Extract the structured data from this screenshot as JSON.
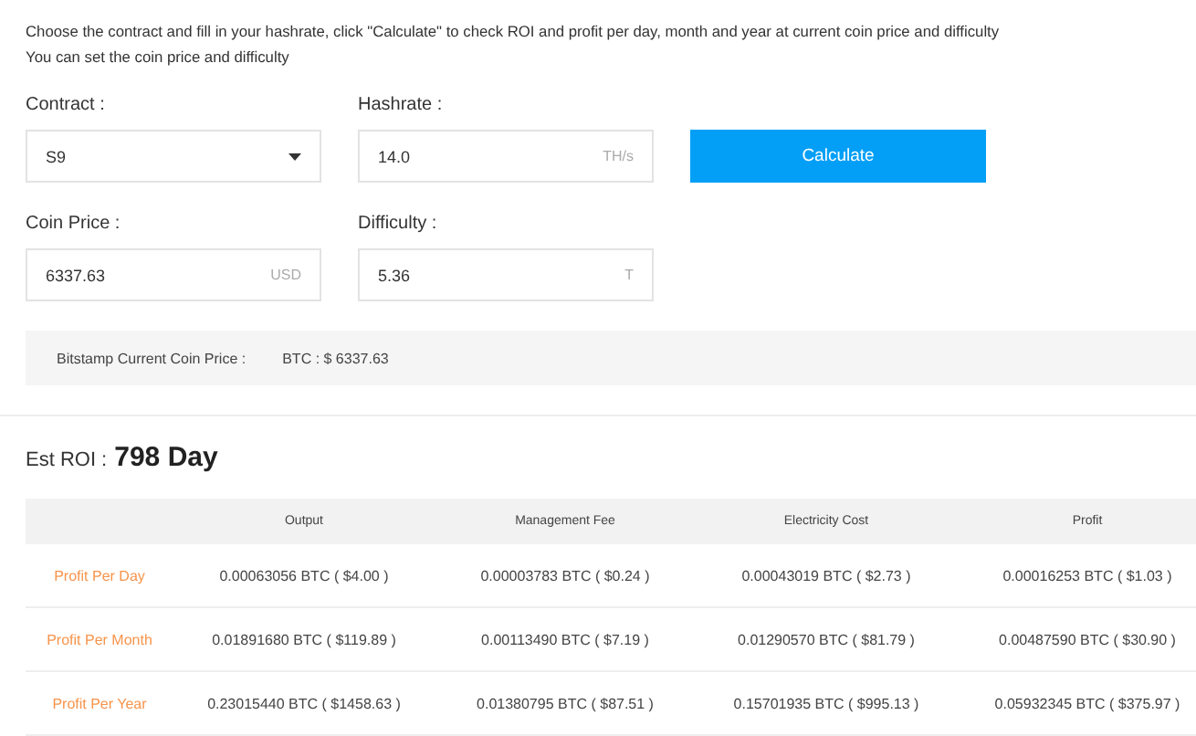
{
  "intro": [
    "Choose the contract and fill in your hashrate, click \"Calculate\" to check ROI and profit per day, month and year at current coin price and difficulty",
    "You can set the coin price and difficulty"
  ],
  "fields": [
    {
      "kind": "select",
      "label": "Contract :",
      "value": "S9"
    },
    {
      "kind": "input",
      "label": "Hashrate :",
      "value": "14.0",
      "unit": "TH/s"
    },
    {
      "kind": "input",
      "label": "Coin Price :",
      "value": "6337.63",
      "unit": "USD"
    },
    {
      "kind": "input",
      "label": "Difficulty :",
      "value": "5.36",
      "unit": "T"
    }
  ],
  "calculate_button": "Calculate",
  "current_price": {
    "label": "Bitstamp Current Coin Price :",
    "value": "BTC : $ 6337.63"
  },
  "roi": {
    "label": "Est ROI :",
    "value": "798 Day"
  },
  "table": {
    "columns": [
      "Output",
      "Management Fee",
      "Electricity Cost",
      "Profit"
    ],
    "rows": [
      {
        "label": "Profit Per Day",
        "cells": [
          "0.00063056 BTC ( $4.00 )",
          "0.00003783 BTC ( $0.24 )",
          "0.00043019 BTC ( $2.73 )",
          "0.00016253 BTC ( $1.03 )"
        ]
      },
      {
        "label": "Profit Per Month",
        "cells": [
          "0.01891680 BTC ( $119.89 )",
          "0.00113490 BTC ( $7.19 )",
          "0.01290570 BTC ( $81.79 )",
          "0.00487590 BTC ( $30.90 )"
        ]
      },
      {
        "label": "Profit Per Year",
        "cells": [
          "0.23015440 BTC ( $1458.63 )",
          "0.01380795 BTC ( $87.51 )",
          "0.15701935 BTC ( $995.13 )",
          "0.05932345 BTC ( $375.97 )"
        ]
      }
    ]
  }
}
